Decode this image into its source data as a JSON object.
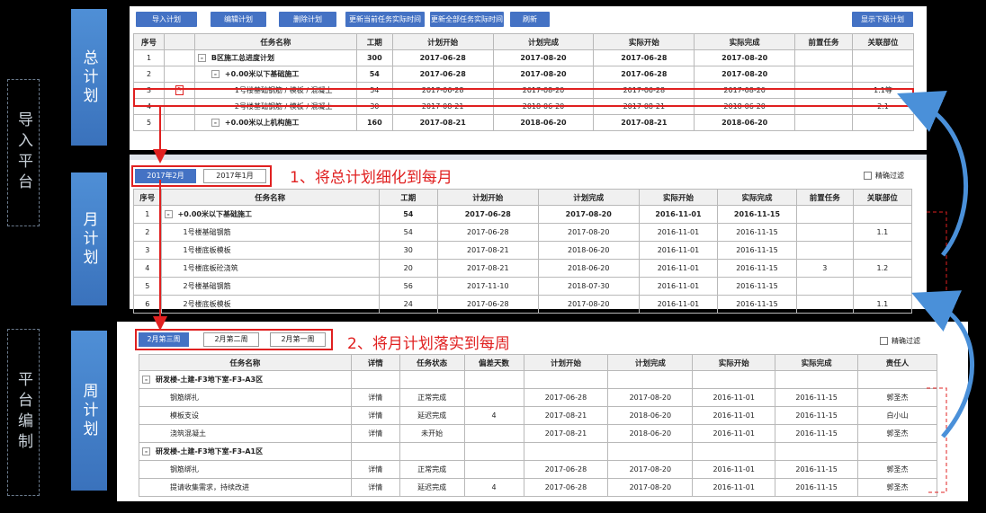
{
  "side_labels": {
    "import": "导入平台",
    "edit": "平台编制"
  },
  "sections": {
    "master": "总计划",
    "monthly": "月计划",
    "weekly": "周计划"
  },
  "toolbar": {
    "import_plan": "导入计划",
    "edit_plan": "编辑计划",
    "delete_plan": "删除计划",
    "update_current": "更新当前任务实际时间",
    "update_all": "更新全部任务实际时间",
    "refresh": "刷新",
    "show_sub": "显示下级计划"
  },
  "master_table": {
    "headers": [
      "序号",
      "",
      "任务名称",
      "工期",
      "计划开始",
      "计划完成",
      "实际开始",
      "实际完成",
      "前置任务",
      "关联部位"
    ],
    "rows": [
      [
        "1",
        "",
        "B区施工总进度计划",
        "300",
        "2017-06-28",
        "2017-08-20",
        "2017-06-28",
        "2017-08-20",
        "",
        ""
      ],
      [
        "2",
        "",
        "+0.00米以下基础施工",
        "54",
        "2017-06-28",
        "2017-08-20",
        "2017-06-28",
        "2017-08-20",
        "",
        ""
      ],
      [
        "3",
        "",
        "1号楼基础钢筋 / 模板 / 混凝土",
        "54",
        "2017-06-28",
        "2017-08-20",
        "2017-06-28",
        "2017-08-20",
        "",
        "1.1等"
      ],
      [
        "4",
        "",
        "2号楼基础钢筋 / 模板 / 混凝土",
        "30",
        "2017-08-21",
        "2018-06-20",
        "2017-08-21",
        "2018-06-20",
        "",
        "2.1"
      ],
      [
        "5",
        "",
        "+0.00米以上机构施工",
        "160",
        "2017-08-21",
        "2018-06-20",
        "2017-08-21",
        "2018-06-20",
        "",
        ""
      ]
    ]
  },
  "step1": "1、将总计划细化到每月",
  "step2": "2、将月计划落实到每周",
  "month_tabs": [
    "2017年2月",
    "2017年1月"
  ],
  "week_tabs": [
    "2月第三周",
    "2月第二周",
    "2月第一周"
  ],
  "filter_label": "精确过滤",
  "monthly_table": {
    "headers": [
      "序号",
      "任务名称",
      "工期",
      "计划开始",
      "计划完成",
      "实际开始",
      "实际完成",
      "前置任务",
      "关联部位"
    ],
    "rows": [
      [
        "1",
        "+0.00米以下基础施工",
        "54",
        "2017-06-28",
        "2017-08-20",
        "2016-11-01",
        "2016-11-15",
        "",
        ""
      ],
      [
        "2",
        "1号楼基础钢筋",
        "54",
        "2017-06-28",
        "2017-08-20",
        "2016-11-01",
        "2016-11-15",
        "",
        "1.1"
      ],
      [
        "3",
        "1号楼底板模板",
        "30",
        "2017-08-21",
        "2018-06-20",
        "2016-11-01",
        "2016-11-15",
        "",
        ""
      ],
      [
        "4",
        "1号楼底板砼浇筑",
        "20",
        "2017-08-21",
        "2018-06-20",
        "2016-11-01",
        "2016-11-15",
        "3",
        "1.2"
      ],
      [
        "5",
        "2号楼基础钢筋",
        "56",
        "2017-11-10",
        "2018-07-30",
        "2016-11-01",
        "2016-11-15",
        "",
        ""
      ],
      [
        "6",
        "2号楼底板模板",
        "24",
        "2017-06-28",
        "2017-08-20",
        "2016-11-01",
        "2016-11-15",
        "",
        "1.1"
      ]
    ]
  },
  "weekly_table": {
    "headers": [
      "任务名称",
      "详情",
      "任务状态",
      "偏差天数",
      "计划开始",
      "计划完成",
      "实际开始",
      "实际完成",
      "责任人"
    ],
    "rows": [
      [
        "研发楼-土建-F3地下室-F3-A3区",
        "",
        "",
        "",
        "",
        "",
        "",
        "",
        ""
      ],
      [
        "钢筋绑扎",
        "详情",
        "正常完成",
        "",
        "2017-06-28",
        "2017-08-20",
        "2016-11-01",
        "2016-11-15",
        "郭圣杰"
      ],
      [
        "模板支设",
        "详情",
        "延迟完成",
        "4",
        "2017-08-21",
        "2018-06-20",
        "2016-11-01",
        "2016-11-15",
        "白小山"
      ],
      [
        "浇筑混凝土",
        "详情",
        "未开始",
        "",
        "2017-08-21",
        "2018-06-20",
        "2016-11-01",
        "2016-11-15",
        "郭圣杰"
      ],
      [
        "研发楼-土建-F3地下室-F3-A1区",
        "",
        "",
        "",
        "",
        "",
        "",
        "",
        ""
      ],
      [
        "钢筋绑扎",
        "详情",
        "正常完成",
        "",
        "2017-06-28",
        "2017-08-20",
        "2016-11-01",
        "2016-11-15",
        "郭圣杰"
      ],
      [
        "提请收集需求，持续改进",
        "详情",
        "延迟完成",
        "4",
        "2017-06-28",
        "2017-08-20",
        "2016-11-01",
        "2016-11-15",
        "郭圣杰"
      ]
    ]
  },
  "colors": {
    "accent": "#4472c4",
    "highlight": "#e02020",
    "tab_blue": "#3a72bc"
  }
}
